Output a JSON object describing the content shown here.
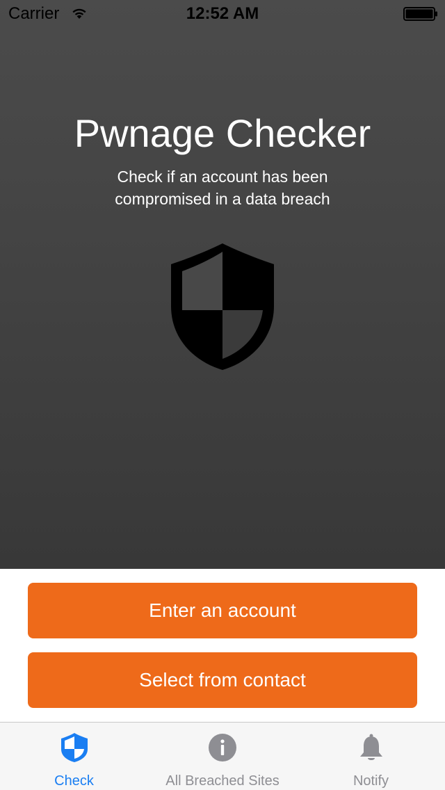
{
  "status_bar": {
    "carrier": "Carrier",
    "time": "12:52 AM"
  },
  "hero": {
    "title": "Pwnage Checker",
    "subtitle": "Check if an account has been compromised in a data breach",
    "icon": "shield-icon"
  },
  "actions": {
    "enter_account_label": "Enter an account",
    "select_contact_label": "Select from contact"
  },
  "tabbar": {
    "tabs": [
      {
        "label": "Check",
        "icon": "shield-icon",
        "active": true
      },
      {
        "label": "All Breached Sites",
        "icon": "info-icon",
        "active": false
      },
      {
        "label": "Notify",
        "icon": "bell-icon",
        "active": false
      }
    ]
  },
  "colors": {
    "accent_orange": "#ee6a1a",
    "active_tab_blue": "#1a7ef2",
    "inactive_tab_gray": "#8e8e93",
    "hero_background": "#444444"
  }
}
